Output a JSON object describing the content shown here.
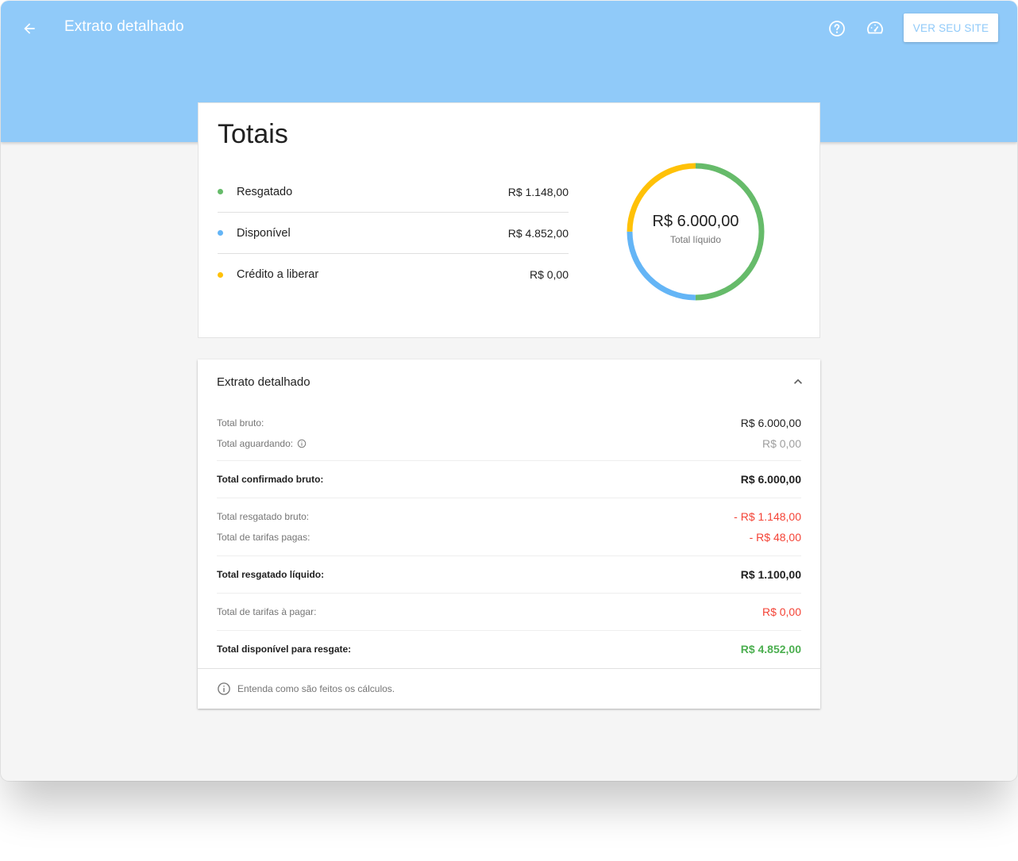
{
  "colors": {
    "appbar": "#90caf9",
    "resgatado": "#66bb6a",
    "disponivel": "#64b5f6",
    "credito": "#ffc107",
    "negative": "#f44336",
    "positive": "#4caf50"
  },
  "header": {
    "title": "Extrato detalhado",
    "back_icon": "arrow-back-icon",
    "help_icon": "help-circle-icon",
    "speed_icon": "speedometer-icon",
    "site_button": "VER SEU SITE"
  },
  "totals": {
    "title": "Totais",
    "items": [
      {
        "label": "Resgatado",
        "value": "R$ 1.148,00",
        "color": "#66bb6a"
      },
      {
        "label": "Disponível",
        "value": "R$ 4.852,00",
        "color": "#64b5f6"
      },
      {
        "label": "Crédito a liberar",
        "value": "R$ 0,00",
        "color": "#ffc107"
      }
    ],
    "donut": {
      "value": "R$ 6.000,00",
      "caption": "Total líquido",
      "segments": [
        {
          "name": "Resgatado",
          "fraction": 0.5,
          "color": "#66bb6a"
        },
        {
          "name": "Disponível",
          "fraction": 0.25,
          "color": "#64b5f6"
        },
        {
          "name": "Crédito a liberar",
          "fraction": 0.25,
          "color": "#ffc107"
        }
      ]
    }
  },
  "extrato": {
    "title": "Extrato detalhado",
    "rows": {
      "total_bruto": {
        "label": "Total bruto:",
        "value": "R$ 6.000,00"
      },
      "total_aguardando": {
        "label": "Total aguardando:",
        "value": "R$ 0,00"
      },
      "total_confirmado": {
        "label": "Total confirmado bruto:",
        "value": "R$ 6.000,00"
      },
      "total_resgatado_bruto": {
        "label": "Total resgatado bruto:",
        "value": "- R$ 1.148,00"
      },
      "total_tarifas_pagas": {
        "label": "Total de tarifas pagas:",
        "value": "- R$ 48,00"
      },
      "total_resgatado_liquido": {
        "label": "Total resgatado líquido:",
        "value": "R$ 1.100,00"
      },
      "total_tarifas_pagar": {
        "label": "Total de tarifas à pagar:",
        "value": "R$ 0,00"
      },
      "total_disponivel": {
        "label": "Total disponível para resgate:",
        "value": "R$ 4.852,00"
      }
    },
    "footer": "Entenda como são feitos os cálculos."
  }
}
